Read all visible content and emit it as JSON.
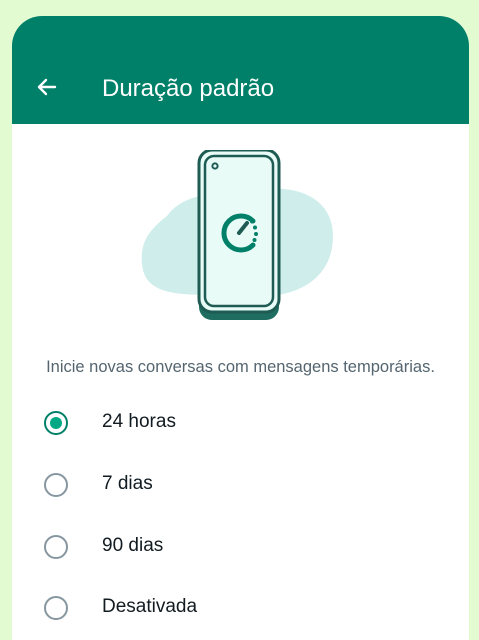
{
  "header": {
    "title": "Duração padrão",
    "back_icon": "arrow-left-icon"
  },
  "illustration": {
    "icon": "phone-timer-icon"
  },
  "description": "Inicie novas conversas com mensagens temporárias.",
  "options": [
    {
      "label": "24 horas",
      "selected": true
    },
    {
      "label": "7 dias",
      "selected": false
    },
    {
      "label": "90 dias",
      "selected": false
    },
    {
      "label": "Desativada",
      "selected": false
    }
  ],
  "colors": {
    "app_bar": "#008069",
    "accent": "#00a884",
    "outer_background": "#e3fbd0",
    "illustration_blob": "#cfeeeb",
    "illustration_dark": "#1d5b53"
  }
}
